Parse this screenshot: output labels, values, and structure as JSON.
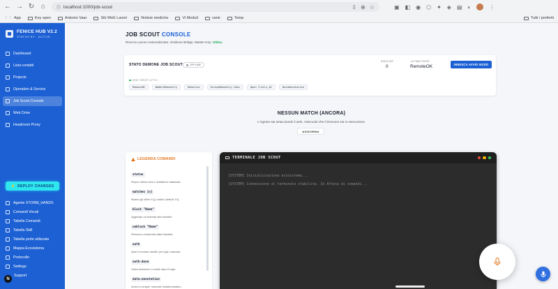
{
  "browser": {
    "url": "localhost:1000/job-scout",
    "bookmarks": [
      "App",
      "Key open",
      "Antonio Vaar",
      "Sib WeE Lavori",
      "Notizie mediche",
      "Vi Moduli",
      "varie",
      "Temp"
    ],
    "all_bookmarks": "Tutti i preferiti"
  },
  "sidebar": {
    "brand": "FENICE HUB V2.2",
    "brand_sub": "STATUS BY · ACTIVE",
    "items": [
      {
        "label": "Dashboard"
      },
      {
        "label": "Lista contatti"
      },
      {
        "label": "Projects"
      },
      {
        "label": "Operation & Service"
      },
      {
        "label": "Job Scout Console"
      },
      {
        "label": "Web Drive"
      },
      {
        "label": "Headroom Proxy"
      }
    ],
    "active_index": 4,
    "deploy_label": "DEPLOY CHANGES",
    "bottom_items": [
      {
        "label": "Agente STORM_HANDS"
      },
      {
        "label": "Comandi Vocali"
      },
      {
        "label": "Tabella Comandi"
      },
      {
        "label": "Tabella Skill"
      },
      {
        "label": "Tabella porte utilizzate"
      },
      {
        "label": "Mappa Ecosistema"
      },
      {
        "label": "Protocollo"
      },
      {
        "label": "Settings"
      },
      {
        "label": "Support"
      }
    ],
    "n_badge": "N"
  },
  "page": {
    "title_main": "JOB SCOUT",
    "title_accent": "CONSOLE",
    "subtitle": "Ricerca Lavoro Automatizzata. Gestione Bridge, Master Key:",
    "subtitle_status": "Attiva."
  },
  "status_card": {
    "label": "STATO DEMONE JOB SCOUT",
    "state": "OFFLINE",
    "matches_label": "RISULTATI",
    "matches_value": "0",
    "source_label": "ULTIMA FONTE",
    "source_value": "RemoteOK",
    "button_label": "INNESCA AVVIO NODO",
    "targets_label": "NODI TARGET ATTIVI",
    "targets": [
      "RemoteOK",
      "WeWorkRemotely",
      "Remotive",
      "EuropeRemotely.Jobs",
      "Open Trails_AI",
      "DataAnnotation"
    ]
  },
  "empty_state": {
    "title": "NESSUN MATCH (ANCORA)",
    "text": "L'Agente sta setacciando il web. Assicurati che il Demone sia in esecuzione.",
    "button": "AGGIORNA"
  },
  "legend": {
    "title": "LEGENDA COMANDI",
    "commands": [
      {
        "name": "status",
        "desc": "Report ultimo ciclo e statistiche database."
      },
      {
        "name": "matches [n]",
        "desc": "Mostra gli ultimi N (|) match (default 10)."
      },
      {
        "name": "block \"Nome\"",
        "desc": "Aggiunge un'azienda alla blacklist."
      },
      {
        "name": "unblock \"Nome\"",
        "desc": "Rimuove un'azienda dalla blacklist."
      },
      {
        "name": "auth",
        "desc": "Apre il browser stealth per login manuale."
      },
      {
        "name": "auth-done",
        "desc": "Salva sessione e cookie dopo il login."
      },
      {
        "name": "data-annotation",
        "desc": "Avvia lo scraper manuale DataAnnotation."
      }
    ]
  },
  "terminal": {
    "title": "TERMINALE JOB SCOUT",
    "lines": [
      "[SYSTEM] Inizializzazione ecosistema...",
      "[SYSTEM] Connessione al terminale stabilita. In Attesa di comandi..."
    ]
  },
  "colors": {
    "sidebar": "#1c60d4",
    "accent": "#1c60d4",
    "deploy": "#2ee6f0",
    "legend_accent": "#e2741a",
    "terminal_bg": "#2c2c2c"
  }
}
